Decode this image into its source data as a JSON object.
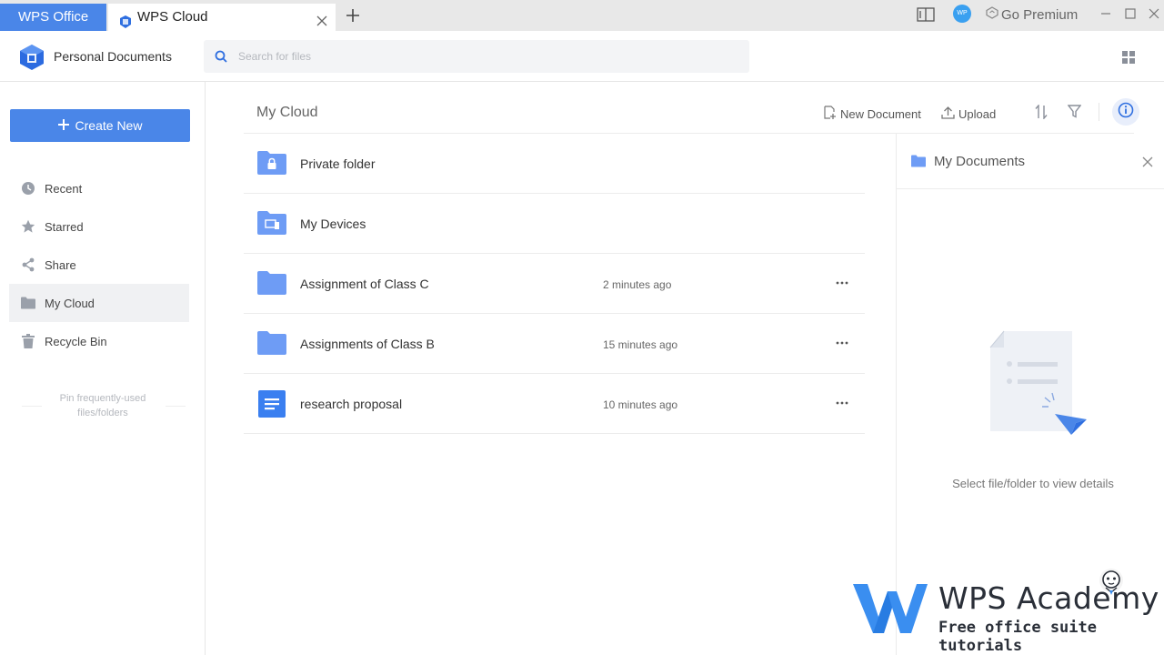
{
  "titlebar": {
    "app_tab": "WPS Office",
    "active_tab": "WPS Cloud",
    "go_premium": "Go Premium",
    "avatar_initials": "WP"
  },
  "header": {
    "title": "Personal Documents",
    "search_placeholder": "Search for files"
  },
  "sidebar": {
    "create_label": "Create New",
    "items": [
      {
        "label": "Recent",
        "icon": "clock-icon"
      },
      {
        "label": "Starred",
        "icon": "star-icon"
      },
      {
        "label": "Share",
        "icon": "share-icon"
      },
      {
        "label": "My Cloud",
        "icon": "folder-icon",
        "active": true
      },
      {
        "label": "Recycle Bin",
        "icon": "trash-icon"
      }
    ],
    "pin_hint_line1": "Pin frequently-used",
    "pin_hint_line2": "files/folders"
  },
  "main": {
    "title": "My Cloud",
    "new_document_label": "New Document",
    "upload_label": "Upload",
    "files": [
      {
        "name": "Private folder",
        "time": "",
        "icon": "lock-folder-icon"
      },
      {
        "name": "My Devices",
        "time": "",
        "icon": "devices-folder-icon"
      },
      {
        "name": "Assignment of Class C",
        "time": "2 minutes ago",
        "icon": "folder-icon"
      },
      {
        "name": "Assignments of Class B",
        "time": "15 minutes ago",
        "icon": "folder-icon"
      },
      {
        "name": "research proposal",
        "time": "10 minutes ago",
        "icon": "document-icon"
      }
    ]
  },
  "details": {
    "title": "My Documents",
    "empty_text": "Select file/folder to view details"
  },
  "watermark": {
    "title": "WPS Academy",
    "subtitle": "Free office suite tutorials"
  },
  "colors": {
    "accent": "#4a86e8",
    "folder": "#6e9cf5",
    "titlebar_bg": "#e8e8e8"
  }
}
